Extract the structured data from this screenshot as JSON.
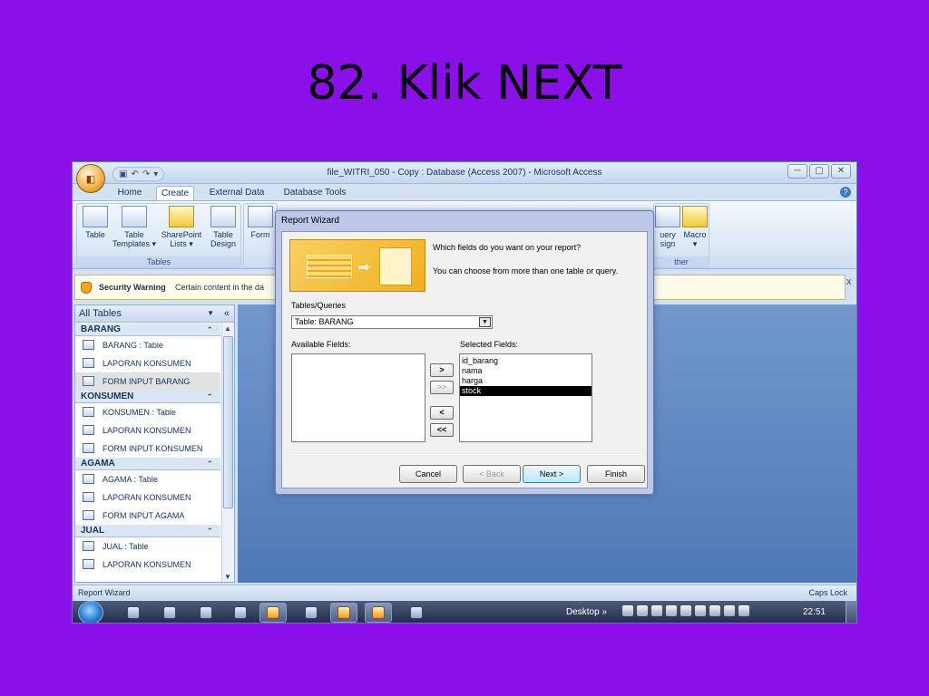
{
  "slide": {
    "title": "82. Klik NEXT"
  },
  "window": {
    "title": "file_WITRI_050 - Copy : Database (Access 2007) - Microsoft Access",
    "office_button_label": "",
    "controls": {
      "minimize": "─",
      "restore": "▢",
      "close": "✕"
    }
  },
  "ribbon": {
    "tabs": [
      "Home",
      "Create",
      "External Data",
      "Database Tools"
    ],
    "active_tab": "Create",
    "groups": {
      "tables": {
        "label": "Tables",
        "buttons": [
          {
            "label": "Table"
          },
          {
            "label": "Table Templates ▾"
          },
          {
            "label": "SharePoint Lists ▾"
          },
          {
            "label": "Table Design"
          }
        ]
      },
      "forms": {
        "buttons": [
          {
            "label": "Form"
          }
        ]
      },
      "other": {
        "label": "ther",
        "buttons": [
          {
            "label": "uery sign"
          },
          {
            "label": "Macro ▾"
          }
        ]
      }
    }
  },
  "security": {
    "label": "Security Warning",
    "text": "Certain content in the da",
    "close": "x"
  },
  "nav": {
    "header": "All Tables",
    "groups": [
      {
        "name": "BARANG",
        "items": [
          "BARANG : Table",
          "LAPORAN KONSUMEN",
          "FORM INPUT BARANG"
        ]
      },
      {
        "name": "KONSUMEN",
        "items": [
          "KONSUMEN : Table",
          "LAPORAN KONSUMEN",
          "FORM INPUT KONSUMEN"
        ]
      },
      {
        "name": "AGAMA",
        "items": [
          "AGAMA : Table",
          "LAPORAN KONSUMEN",
          "FORM INPUT AGAMA"
        ]
      },
      {
        "name": "JUAL",
        "items": [
          "JUAL : Table",
          "LAPORAN KONSUMEN"
        ]
      }
    ],
    "selected_item": "FORM INPUT BARANG"
  },
  "wizard": {
    "title": "Report Wizard",
    "question": "Which fields do you want on your report?",
    "hint": "You can choose from more than one table or query.",
    "tables_label": "Tables/Queries",
    "table_value": "Table: BARANG",
    "available_label": "Available Fields:",
    "selected_label": "Selected Fields:",
    "available_fields": [],
    "selected_fields": [
      "id_barang",
      "nama",
      "harga",
      "stock"
    ],
    "highlighted_field": "stock",
    "move_buttons": [
      ">",
      ">>",
      "<",
      "<<"
    ],
    "buttons": {
      "cancel": "Cancel",
      "back": "< Back",
      "next": "Next >",
      "finish": "Finish"
    }
  },
  "statusbar": {
    "left": "Report Wizard",
    "right": "Caps Lock"
  },
  "taskbar": {
    "desktop": "Desktop",
    "chevron": "»",
    "clock": "22:51"
  },
  "colors": {
    "slide_bg": "#8b10e8",
    "workarea": "#5b84be",
    "selection": "#000000"
  }
}
